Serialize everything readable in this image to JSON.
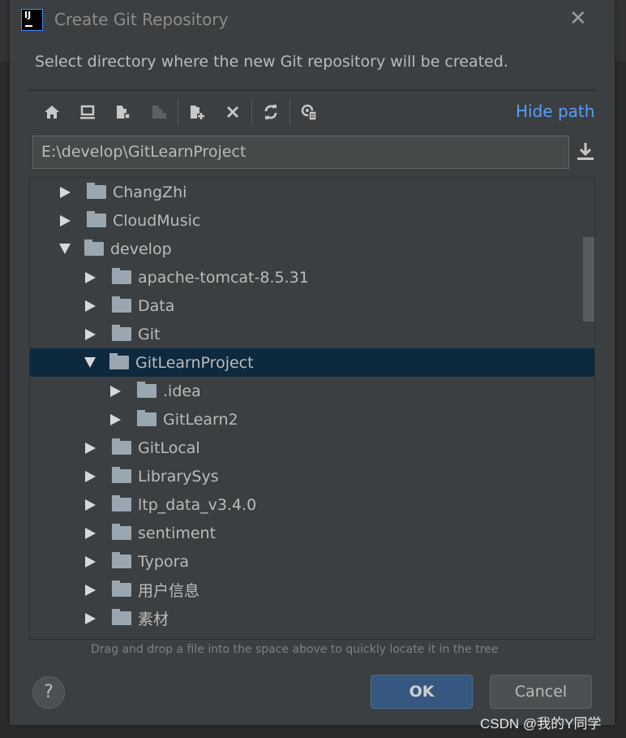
{
  "dialog": {
    "title": "Create Git Repository",
    "description": "Select directory where the new Git repository will be created.",
    "hide_path_label": "Hide path",
    "path_value": "E:\\develop\\GitLearnProject",
    "hint": "Drag and drop a file into the space above to quickly locate it in the tree",
    "ok_label": "OK",
    "cancel_label": "Cancel",
    "help_label": "?"
  },
  "toolbar": [
    "home-icon",
    "desktop-icon",
    "project-folder-icon",
    "module-folder-icon",
    "new-folder-icon",
    "delete-icon",
    "refresh-icon",
    "show-hidden-icon"
  ],
  "tree": [
    {
      "label": "ChangZhi",
      "level": 0,
      "expanded": false
    },
    {
      "label": "CloudMusic",
      "level": 0,
      "expanded": false
    },
    {
      "label": "develop",
      "level": 0,
      "expanded": true
    },
    {
      "label": "apache-tomcat-8.5.31",
      "level": 1,
      "expanded": false
    },
    {
      "label": "Data",
      "level": 1,
      "expanded": false
    },
    {
      "label": "Git",
      "level": 1,
      "expanded": false
    },
    {
      "label": "GitLearnProject",
      "level": 1,
      "expanded": true,
      "selected": true
    },
    {
      "label": ".idea",
      "level": 2,
      "expanded": false
    },
    {
      "label": "GitLearn2",
      "level": 2,
      "expanded": false
    },
    {
      "label": "GitLocal",
      "level": 1,
      "expanded": false
    },
    {
      "label": "LibrarySys",
      "level": 1,
      "expanded": false
    },
    {
      "label": "ltp_data_v3.4.0",
      "level": 1,
      "expanded": false
    },
    {
      "label": "sentiment",
      "level": 1,
      "expanded": false
    },
    {
      "label": "Typora",
      "level": 1,
      "expanded": false
    },
    {
      "label": "用户信息",
      "level": 1,
      "expanded": false
    },
    {
      "label": "素材",
      "level": 1,
      "expanded": false
    }
  ],
  "watermark": "CSDN @我的Y同学",
  "colors": {
    "background": "#3c3f41",
    "selection": "#0d293e",
    "link": "#589df6",
    "ok_button": "#365880"
  }
}
